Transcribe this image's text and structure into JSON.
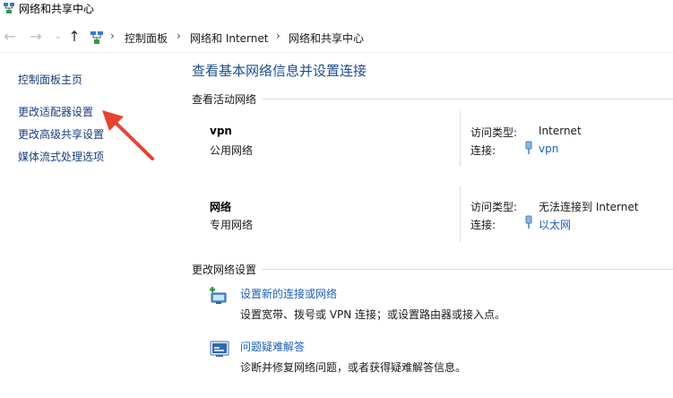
{
  "window": {
    "title": "网络和共享中心"
  },
  "breadcrumb": [
    "控制面板",
    "网络和 Internet",
    "网络和共享中心"
  ],
  "sidebar": {
    "items": [
      {
        "label": "控制面板主页"
      },
      {
        "label": "更改适配器设置"
      },
      {
        "label": "更改高级共享设置"
      },
      {
        "label": "媒体流式处理选项"
      }
    ]
  },
  "main": {
    "title": "查看基本网络信息并设置连接",
    "active_section": "查看活动网络",
    "access_type_label": "访问类型:",
    "connection_label": "连接:",
    "networks": [
      {
        "name": "vpn",
        "category": "公用网络",
        "access": "Internet",
        "connection": "vpn"
      },
      {
        "name": "网络",
        "category": "专用网络",
        "access": "无法连接到 Internet",
        "connection": "以太网"
      }
    ],
    "change_section": "更改网络设置",
    "tasks": [
      {
        "link": "设置新的连接或网络",
        "desc": "设置宽带、拨号或 VPN 连接；或设置路由器或接入点。"
      },
      {
        "link": "问题疑难解答",
        "desc": "诊断并修复网络问题，或者获得疑难解答信息。"
      }
    ]
  },
  "colors": {
    "link": "#1a5fb4",
    "title": "#1e4e8c",
    "annotation_arrow": "#e8432f"
  }
}
